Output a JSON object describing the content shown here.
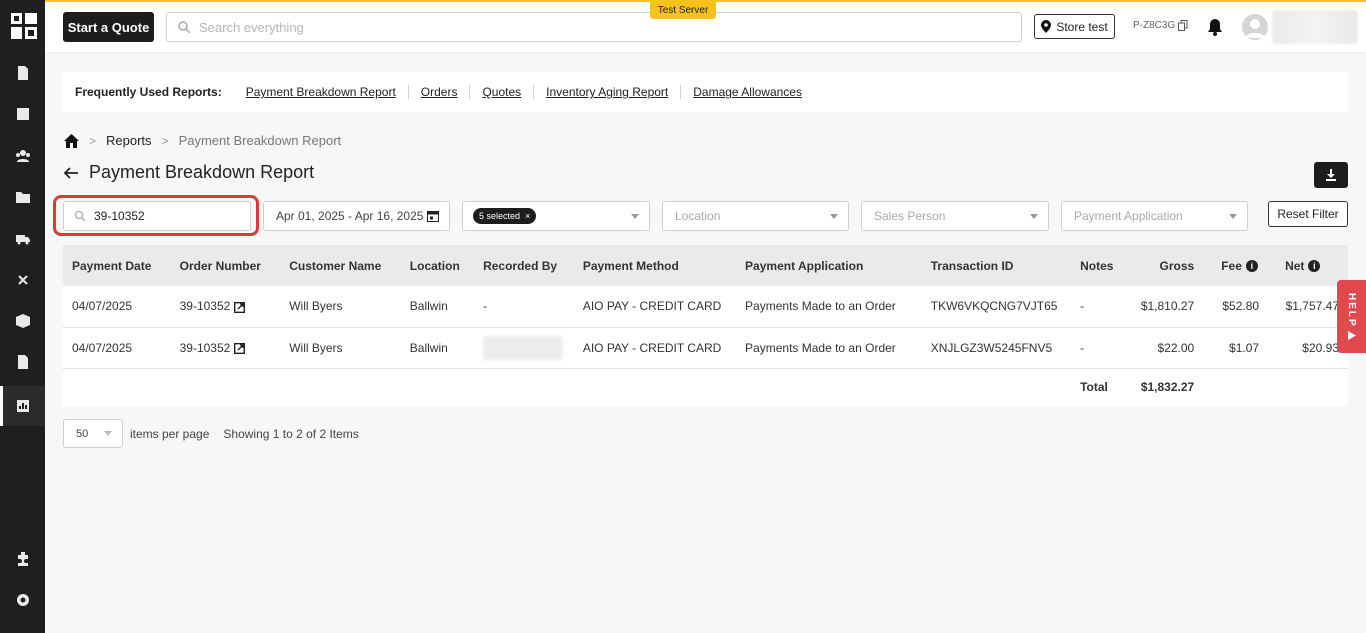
{
  "header": {
    "start_quote": "Start a Quote",
    "search_placeholder": "Search everything",
    "test_badge": "Test Server",
    "store_label": "Store test",
    "project_code": "P-Z8C3G"
  },
  "frequent_reports": {
    "label": "Frequently Used Reports:",
    "links": [
      "Payment Breakdown Report",
      "Orders",
      "Quotes",
      "Inventory Aging Report",
      "Damage Allowances"
    ]
  },
  "breadcrumb": {
    "items": [
      "Reports",
      "Payment Breakdown Report"
    ]
  },
  "page": {
    "title": "Payment Breakdown Report"
  },
  "filters": {
    "search_value": "39-10352",
    "date_range": "Apr 01, 2025 - Apr 16, 2025",
    "status_chip": "5 selected",
    "location_placeholder": "Location",
    "sales_person_placeholder": "Sales Person",
    "payment_application_placeholder": "Payment Application",
    "reset_label": "Reset Filter"
  },
  "table": {
    "columns": [
      "Payment Date",
      "Order Number",
      "Customer Name",
      "Location",
      "Recorded By",
      "Payment Method",
      "Payment Application",
      "Transaction ID",
      "Notes",
      "Gross",
      "Fee",
      "Net"
    ],
    "rows": [
      {
        "payment_date": "04/07/2025",
        "order_number": "39-10352",
        "customer": "Will Byers",
        "location": "Ballwin",
        "recorded_by": "-",
        "method": "AIO PAY - CREDIT CARD",
        "application": "Payments Made to an Order",
        "transaction_id": "TKW6VKQCNG7VJT65",
        "notes": "-",
        "gross": "$1,810.27",
        "fee": "$52.80",
        "net": "$1,757.47"
      },
      {
        "payment_date": "04/07/2025",
        "order_number": "39-10352",
        "customer": "Will Byers",
        "location": "Ballwin",
        "recorded_by": "",
        "method": "AIO PAY - CREDIT CARD",
        "application": "Payments Made to an Order",
        "transaction_id": "XNJLGZ3W5245FNV5",
        "notes": "-",
        "gross": "$22.00",
        "fee": "$1.07",
        "net": "$20.93"
      }
    ],
    "total_label": "Total",
    "total_gross": "$1,832.27"
  },
  "pager": {
    "per_page": "50",
    "per_page_label": "items per page",
    "showing": "Showing 1 to 2 of 2 Items"
  },
  "help": {
    "label": "HELP"
  }
}
